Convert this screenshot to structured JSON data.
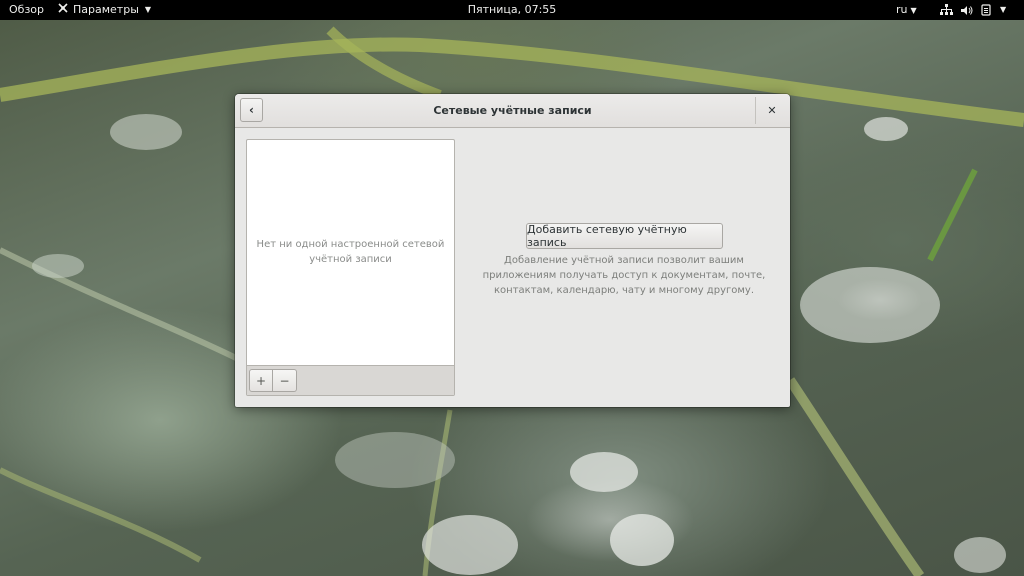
{
  "topbar": {
    "activities": "Обзор",
    "app_menu": {
      "icon": "settings-gear-icon",
      "label": "Параметры"
    },
    "clock": "Пятница, 07:55",
    "language": "ru",
    "tray_icons": [
      "network-wired-icon",
      "volume-icon",
      "power-menu-icon"
    ]
  },
  "dialog": {
    "title": "Сетевые учётные записи",
    "back_icon": "back-arrow-icon",
    "close_icon": "close-icon",
    "accounts_list": {
      "empty_text": "Нет ни одной настроенной сетевой учётной записи",
      "add_icon": "plus-icon",
      "remove_icon": "minus-icon"
    },
    "add_button_label": "Добавить сетевую учётную запись",
    "add_description": "Добавление учётной записи позволит вашим приложениям получать доступ к документам, почте, контактам, календарю, чату и многому другому."
  },
  "colors": {
    "topbar_bg": "#000000",
    "dialog_bg": "#e8e8e7",
    "list_bg": "#ffffff"
  }
}
